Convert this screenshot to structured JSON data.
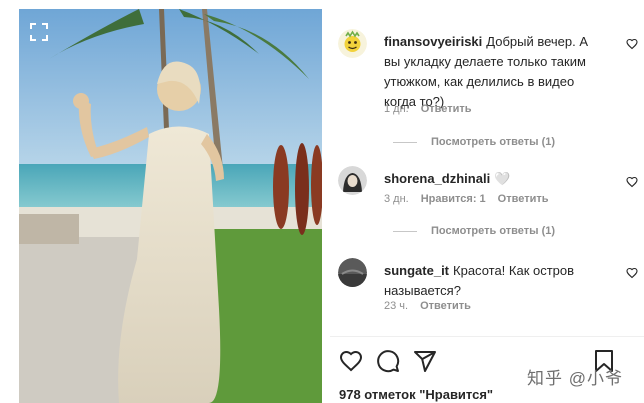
{
  "comments": [
    {
      "username": "finansovyeiriski",
      "text": "Добрый вечер. А вы укладку делаете только таким утюжком, как делились в видео когда то?)",
      "time": "1 дн.",
      "reply": "Ответить",
      "view_replies": "Посмотреть ответы (1)"
    },
    {
      "username": "shorena_dzhinali",
      "text": "🤍",
      "time": "3 дн.",
      "likes": "Нравится: 1",
      "reply": "Ответить",
      "view_replies": "Посмотреть ответы (1)"
    },
    {
      "username": "sungate_it",
      "text": "Красота! Как остров называется?",
      "time": "23 ч.",
      "reply": "Ответить"
    }
  ],
  "likes_text": "978 отметок \"Нравится\"",
  "watermark": "知乎 @小爷",
  "icons": {
    "expand": "expand-icon",
    "like": "heart-icon",
    "comment": "comment-icon",
    "share": "share-icon",
    "save": "bookmark-icon"
  }
}
